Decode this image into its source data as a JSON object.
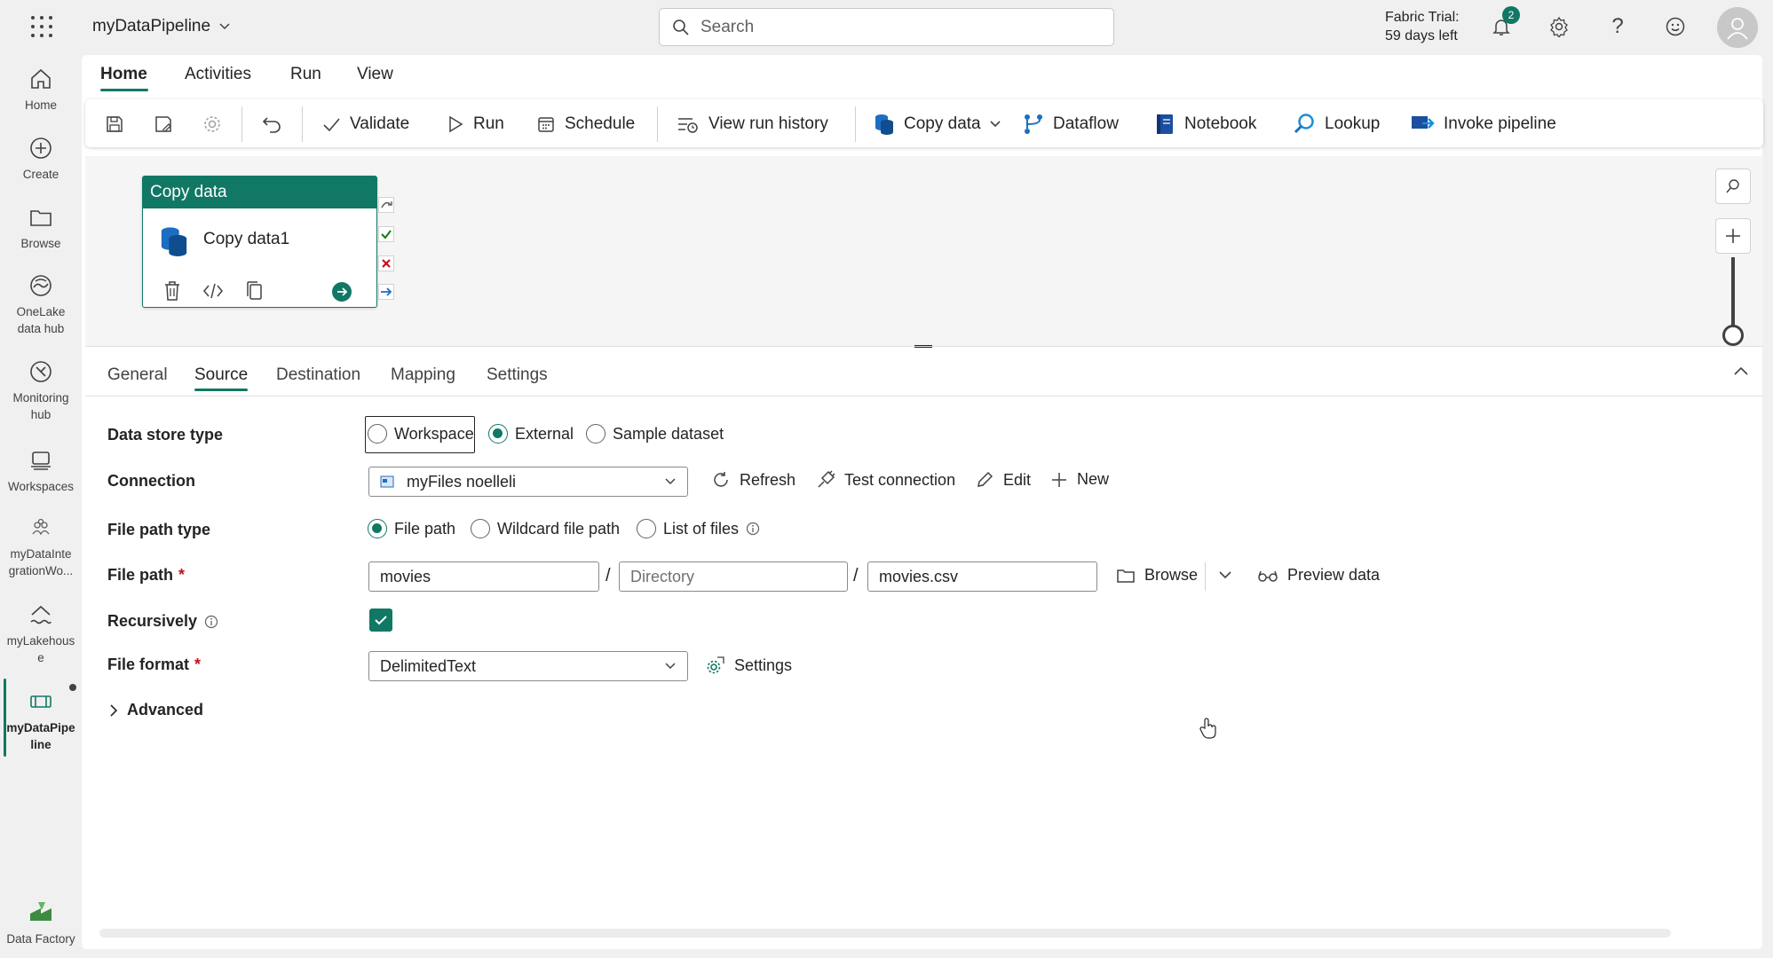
{
  "app": {
    "title": "myDataPipeline",
    "search_placeholder": "Search",
    "trial_line1": "Fabric Trial:",
    "trial_line2": "59 days left",
    "notification_count": "2"
  },
  "rail": {
    "items": [
      {
        "label": "Home",
        "icon": "home-icon"
      },
      {
        "label": "Create",
        "icon": "plus-circle-icon"
      },
      {
        "label": "Browse",
        "icon": "folder-icon"
      },
      {
        "label": "OneLake data hub",
        "icon": "onelake-icon"
      },
      {
        "label": "Monitoring hub",
        "icon": "monitor-icon"
      },
      {
        "label": "Workspaces",
        "icon": "workspaces-icon"
      },
      {
        "label": "myDataInte grationWo...",
        "icon": "workspace-people-icon"
      },
      {
        "label": "myLakehous e",
        "icon": "lakehouse-icon"
      },
      {
        "label": "myDataPipe line",
        "icon": "pipeline-icon"
      }
    ],
    "footer": "Data Factory"
  },
  "menu_tabs": [
    "Home",
    "Activities",
    "Run",
    "View"
  ],
  "toolbar": {
    "validate": "Validate",
    "run": "Run",
    "schedule": "Schedule",
    "view_run_history": "View run history",
    "copy_data": "Copy data",
    "dataflow": "Dataflow",
    "notebook": "Notebook",
    "lookup": "Lookup",
    "invoke_pipeline": "Invoke pipeline"
  },
  "activity": {
    "type": "Copy data",
    "name": "Copy data1"
  },
  "prop_tabs": [
    "General",
    "Source",
    "Destination",
    "Mapping",
    "Settings"
  ],
  "source": {
    "data_store_type_label": "Data store type",
    "data_store_options": [
      "Workspace",
      "External",
      "Sample dataset"
    ],
    "data_store_selected": "External",
    "connection_label": "Connection",
    "connection_value": "myFiles noelleli",
    "refresh": "Refresh",
    "test_connection": "Test connection",
    "edit": "Edit",
    "new": "New",
    "file_path_type_label": "File path type",
    "file_path_type_options": [
      "File path",
      "Wildcard file path",
      "List of files"
    ],
    "file_path_type_selected": "File path",
    "file_path_label": "File path",
    "required_mark": "*",
    "file_path_container": "movies",
    "file_path_directory_placeholder": "Directory",
    "file_path_file": "movies.csv",
    "slash": "/",
    "browse": "Browse",
    "preview_data": "Preview data",
    "recursively_label": "Recursively",
    "recursively_checked": true,
    "file_format_label": "File format",
    "file_format_value": "DelimitedText",
    "format_settings": "Settings",
    "advanced": "Advanced"
  },
  "colors": {
    "accent": "#117865",
    "error": "#c50f1f"
  }
}
